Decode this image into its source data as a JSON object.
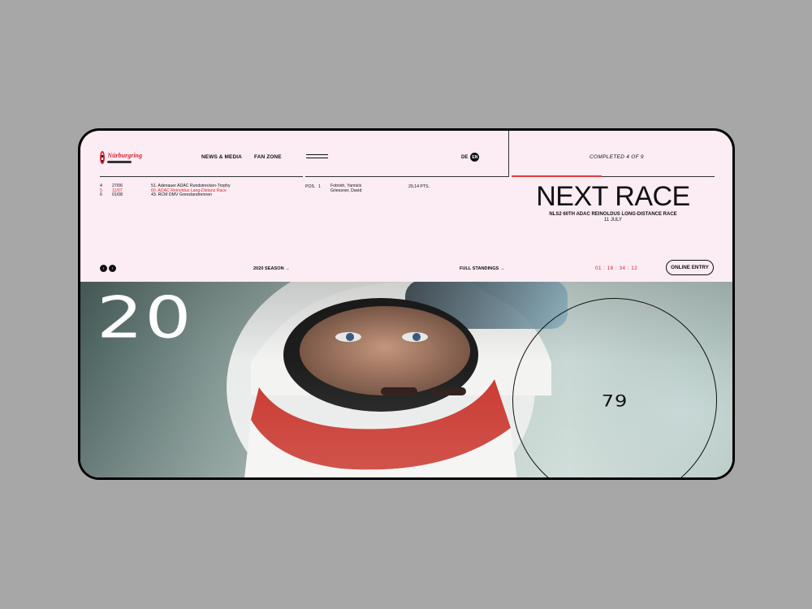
{
  "brand": {
    "logo_text": "Nürburgring"
  },
  "nav": {
    "news": "NEWS & MEDIA",
    "fan_zone": "FAN ZONE"
  },
  "lang": {
    "de": "DE",
    "en": "EN"
  },
  "season_progress": {
    "label": "COMPLETED 4 OF 9",
    "completed": 4,
    "total": 9
  },
  "races": [
    {
      "num": "4",
      "date": "27/06",
      "name": "51. Adenauer ADAC Rundstrecken-Trophy",
      "active": false
    },
    {
      "num": "5",
      "date": "11/07",
      "name": "60. ADAC Reinoldus Lang-Distanz Race",
      "active": true
    },
    {
      "num": "6",
      "date": "01/08",
      "name": "43. RCM DMV Grenzlandrennen",
      "active": false
    }
  ],
  "standings": {
    "pos_label": "POS.",
    "pos": "1",
    "drivers": [
      "Fobrish, Yannick",
      "Griessner, David"
    ],
    "points": "29,14 PTS."
  },
  "next_race": {
    "title": "NEXT RACE",
    "name": "NLS2 60TH ADAC REINOLDUS LONG-DISTANCE RACE",
    "date": "11 JULY"
  },
  "controls": {
    "prev_icon": "chevron-left-icon",
    "next_icon": "chevron-right-icon",
    "season_link": "2020 SEASON →",
    "standings_link": "FULL STANDINGS →",
    "countdown": "01 : 16 : 34 : 12",
    "entry_button": "ONLINE ENTRY"
  },
  "hero": {
    "year": "20",
    "car_number": "79"
  },
  "colors": {
    "background": "#fcecf3",
    "accent": "#e23a3a",
    "frame": "#000000"
  }
}
